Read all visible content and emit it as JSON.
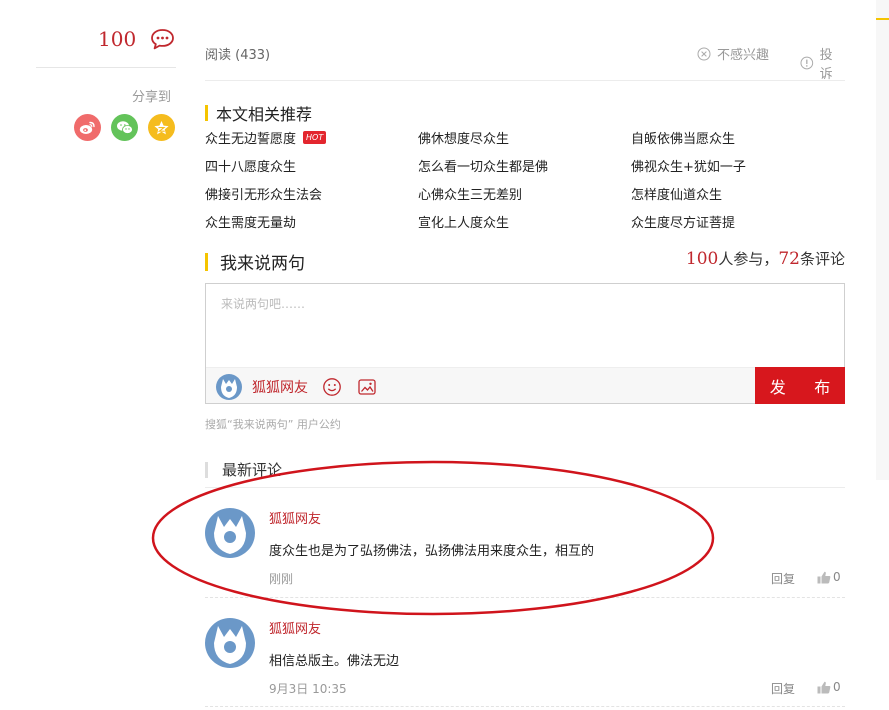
{
  "sidebar": {
    "comment_count": "100",
    "share_label": "分享到",
    "share_targets": [
      "weibo-icon",
      "wechat-icon",
      "qzone-icon"
    ]
  },
  "article_meta": {
    "read_label": "阅读 (433)",
    "not_interested": "不感兴趣",
    "report": "投诉"
  },
  "recommend": {
    "title": "本文相关推荐",
    "hot_badge": "HOT",
    "items": [
      "众生无边誓愿度",
      "佛休想度尽众生",
      "自皈依佛当愿众生",
      "四十八愿度众生",
      "怎么看一切众生都是佛",
      "佛视众生+犹如一子",
      "佛接引无形众生法会",
      "心佛众生三无差别",
      "怎样度仙道众生",
      "众生需度无量劫",
      "宣化上人度众生",
      "众生度尽方证菩提"
    ]
  },
  "comment_section": {
    "title": "我来说两句",
    "participants": "100",
    "participants_suffix": "人参与，",
    "comments": "72",
    "comments_suffix": "条评论",
    "placeholder": "来说两句吧……",
    "username": "狐狐网友",
    "publish_label": "发 布",
    "agreement": "搜狐“我来说两句” 用户公约"
  },
  "latest": {
    "title": "最新评论",
    "comments": [
      {
        "user": "狐狐网友",
        "text": "度众生也是为了弘扬佛法，弘扬佛法用来度众生，相互的",
        "time": "刚刚",
        "reply": "回复",
        "likes": "0"
      },
      {
        "user": "狐狐网友",
        "text": "相信总版主。佛法无边",
        "time": "9月3日 10:35",
        "reply": "回复",
        "likes": "0"
      }
    ]
  },
  "colors": {
    "brand_red": "#c0282e",
    "publish_red": "#d7171d",
    "accent_yellow": "#f5c400",
    "annotation_red": "#d0141c"
  }
}
